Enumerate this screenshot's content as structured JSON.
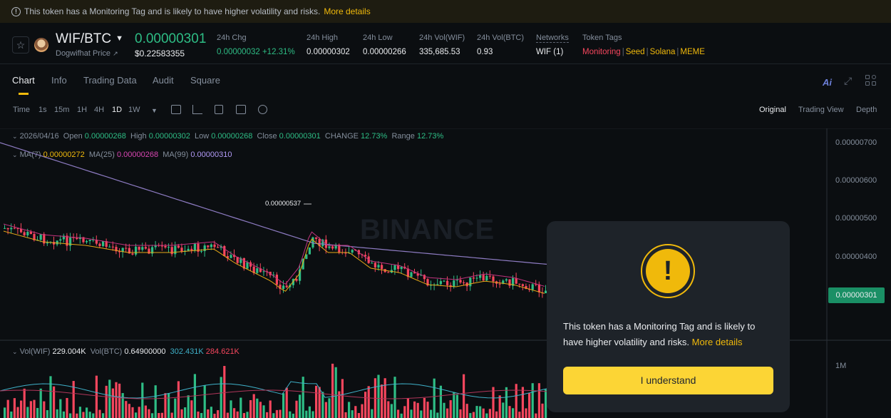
{
  "banner": {
    "text": "This token has a Monitoring Tag and is likely to have higher volatility and risks.",
    "link": "More details"
  },
  "header": {
    "pair": "WIF/BTC",
    "subtitle": "Dogwifhat Price",
    "price": "0.00000301",
    "usd_price": "$0.22583355",
    "stats": [
      {
        "label": "24h Chg",
        "value": "0.00000032 +12.31%"
      },
      {
        "label": "24h High",
        "value": "0.00000302"
      },
      {
        "label": "24h Low",
        "value": "0.00000266"
      },
      {
        "label": "24h Vol(WIF)",
        "value": "335,685.53"
      },
      {
        "label": "24h Vol(BTC)",
        "value": "0.93"
      },
      {
        "label": "Networks",
        "value": "WIF (1)"
      },
      {
        "label": "Token Tags",
        "value": ""
      }
    ],
    "tags": [
      "Monitoring",
      "Seed",
      "Solana",
      "MEME"
    ]
  },
  "tabs": [
    "Chart",
    "Info",
    "Trading Data",
    "Audit",
    "Square"
  ],
  "ai_label": "Ai",
  "toolbar": {
    "intervals": [
      "Time",
      "1s",
      "15m",
      "1H",
      "4H",
      "1D",
      "1W"
    ],
    "active_interval": "1D",
    "views": [
      "Original",
      "Trading View",
      "Depth"
    ]
  },
  "ohlc": {
    "date": "2026/04/16",
    "open_label": "Open",
    "open": "0.00000268",
    "high_label": "High",
    "high": "0.00000302",
    "low_label": "Low",
    "low": "0.00000268",
    "close_label": "Close",
    "close": "0.00000301",
    "change_label": "CHANGE",
    "change": "12.73%",
    "range_label": "Range",
    "range": "12.73%"
  },
  "ma": {
    "ma7_label": "MA(7)",
    "ma7": "0.00000272",
    "ma25_label": "MA(25)",
    "ma25": "0.00000268",
    "ma99_label": "MA(99)",
    "ma99": "0.00000310"
  },
  "vol": {
    "wif_label": "Vol(WIF)",
    "wif": "229.004K",
    "btc_label": "Vol(BTC)",
    "btc": "0.64900000",
    "ma1": "302.431K",
    "ma2": "284.621K"
  },
  "price_axis": [
    "0.00000700",
    "0.00000600",
    "0.00000500",
    "0.00000400"
  ],
  "last_price_tag": "0.00000301",
  "vol_axis": "1M",
  "peak_label": "0.00000537",
  "watermark": "BINANCE",
  "modal": {
    "message": "This token has a Monitoring Tag and is likely to have higher volatility and risks.",
    "link": "More details",
    "button": "I understand"
  },
  "colors": {
    "up": "#2ebd85",
    "down": "#f6465d",
    "accent": "#f0b90b",
    "button": "#fcd535"
  }
}
